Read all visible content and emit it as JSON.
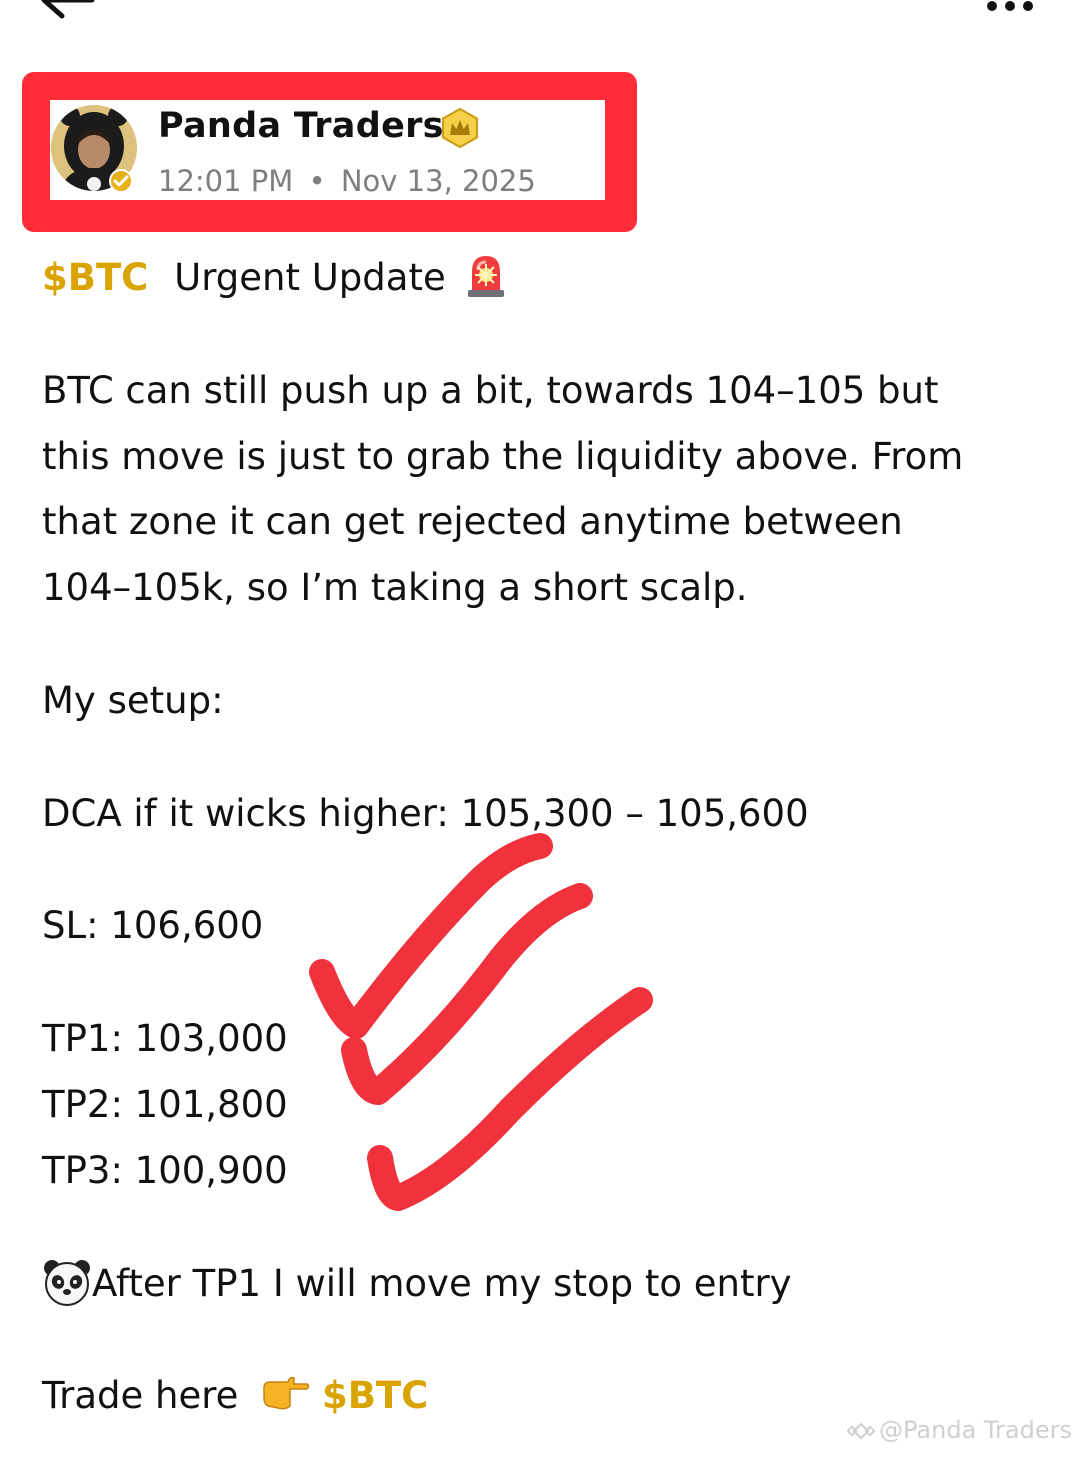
{
  "header": {
    "back_icon": "arrow-left-icon",
    "more_icon": "more-dots-icon"
  },
  "author": {
    "name": "Panda Traders",
    "badge_icon": "crown-badge-icon",
    "verified_icon": "verified-check-icon",
    "time": "12:01 PM",
    "separator": "•",
    "date": "Nov 13, 2025"
  },
  "post": {
    "title_tag": "$BTC",
    "title_text": "Urgent Update",
    "title_emoji": "siren-emoji",
    "paragraph_lines": [
      "BTC can still push up a bit, towards 104–105 but",
      "this move is just to grab the liquidity above. From",
      "that zone it can get rejected anytime between",
      "104–105k, so I’m taking a short scalp."
    ],
    "setup_label": "My setup:",
    "dca_line": "DCA if it wicks higher: 105,300 – 105,600",
    "sl_line": "SL: 106,600",
    "tp1_line": "TP1: 103,000",
    "tp2_line": "TP2: 101,800",
    "tp3_line": "TP3: 100,900",
    "after_emoji": "panda-emoji",
    "after_text": "After TP1 I will move my stop to entry",
    "trade_text": "Trade here",
    "trade_emoji": "pointing-hand-emoji",
    "trade_tag": "$BTC"
  },
  "watermark": {
    "text": "@Panda Traders"
  },
  "colors": {
    "highlight": "#ff2d37",
    "cashtag": "#d9a400",
    "check_marks": "#f0323c",
    "meta_text": "#7e7e7e"
  }
}
